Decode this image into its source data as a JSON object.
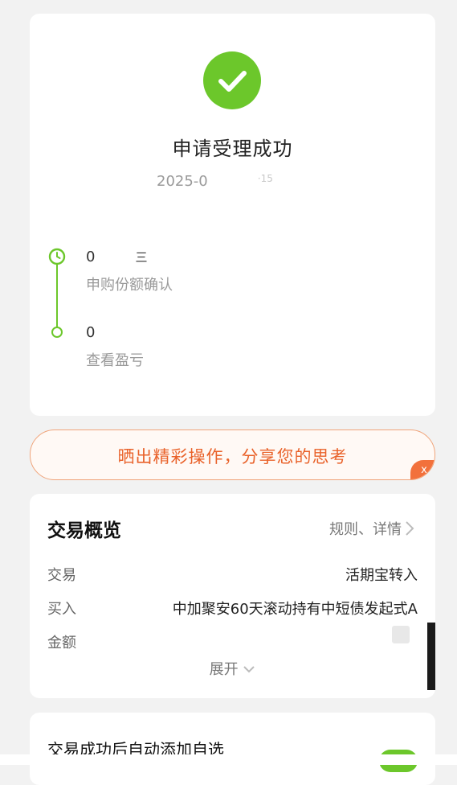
{
  "status": {
    "title": "申请受理成功",
    "time_partial": "2025-0",
    "time_fragment": "·15",
    "icon": "check-icon",
    "accent": "#6cc72b"
  },
  "timeline": [
    {
      "time_partial": "0",
      "time_suffix": "三",
      "label": "申购份额确认",
      "icon": "clock-icon"
    },
    {
      "time_partial": "0",
      "time_suffix": "",
      "label": "查看盈亏",
      "icon": "dot-icon"
    }
  ],
  "share": {
    "text": "晒出精彩操作，分享您的思考",
    "close_label": "x",
    "accent": "#e9622a"
  },
  "overview": {
    "title": "交易概览",
    "link": "规则、详情",
    "rows": [
      {
        "label": "交易",
        "value": "活期宝转入"
      },
      {
        "label": "买入",
        "value": "中加聚安60天滚动持有中短债发起式A"
      },
      {
        "label": "金额",
        "value": ""
      }
    ],
    "expand": "展开"
  },
  "auto_add": {
    "text": "交易成功后自动添加自选",
    "toggle_on": true
  }
}
